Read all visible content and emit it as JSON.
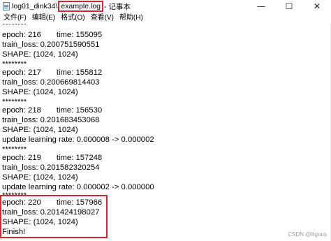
{
  "window": {
    "title_prefix": "log01_dink34\\",
    "title_file": "example.log",
    "title_suffix": "- 记事本",
    "controls": {
      "minimize": "—",
      "maximize": "☐",
      "close": "✕"
    }
  },
  "menu": {
    "items": [
      {
        "label": "文件(F)"
      },
      {
        "label": "编辑(E)"
      },
      {
        "label": "格式(O)"
      },
      {
        "label": "查看(V)"
      },
      {
        "label": "帮助(H)"
      }
    ]
  },
  "content": {
    "lines": [
      "********",
      "epoch: 216       time: 155095",
      "train_loss: 0.200751590551",
      "SHAPE: (1024, 1024)",
      "********",
      "epoch: 217       time: 155812",
      "train_loss: 0.200669814403",
      "SHAPE: (1024, 1024)",
      "********",
      "epoch: 218       time: 156530",
      "train_loss: 0.201683453068",
      "SHAPE: (1024, 1024)",
      "update learning rate: 0.000008 -> 0.000002",
      "********",
      "epoch: 219       time: 157248",
      "train_loss: 0.201582320254",
      "SHAPE: (1024, 1024)",
      "update learning rate: 0.000002 -> 0.000000",
      "********",
      "epoch: 220       time: 157966",
      "train_loss: 0.201424198027",
      "SHAPE: (1024, 1024)",
      "Finish!"
    ]
  },
  "watermark": "CSDN @liigous",
  "colors": {
    "highlight": "#d9262b",
    "text": "#000000",
    "background": "#ffffff"
  }
}
